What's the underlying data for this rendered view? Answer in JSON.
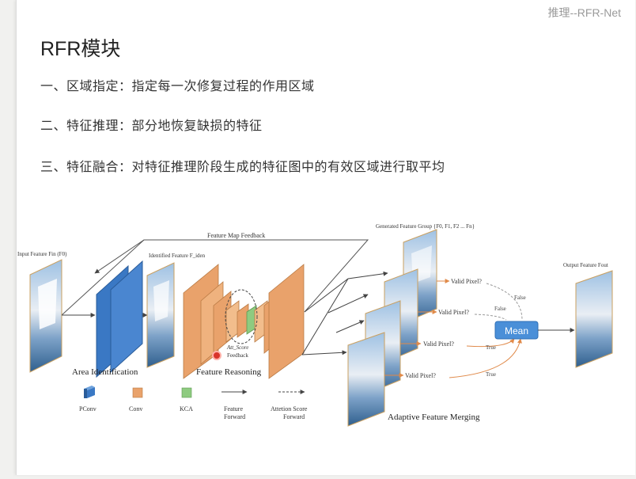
{
  "header": {
    "text": "推理--RFR-Net"
  },
  "title": "RFR模块",
  "bullets": [
    "一、区域指定：指定每一次修复过程的作用区域",
    "二、特征推理：部分地恢复缺损的特征",
    "三、特征融合：对特征推理阶段生成的特征图中的有效区域进行取平均"
  ],
  "diagram": {
    "feedback_label": "Feature Map Feedback",
    "input_label": "Input Feature Fin (F0)",
    "identified_label": "Identified Feature F_iden",
    "generated_label": "Generated Feature Group {F0, F1, F2 ... Fn}",
    "output_label": "Output Feature Fout",
    "att_label": "Att_Score",
    "att_label2": "Feedback",
    "valid_pixel": "Valid Pixel?",
    "mean": "Mean",
    "false_label": "False",
    "true_label": "True",
    "section_labels": {
      "area": "Area Identification",
      "reasoning": "Feature Reasoning",
      "merging": "Adaptive Feature Merging"
    },
    "legend": {
      "pconv": "PConv",
      "conv": "Conv",
      "kca": "KCA",
      "feature_forward": [
        "Feature",
        "Forward"
      ],
      "attention_forward": [
        "Attetion Score",
        "Forward"
      ]
    },
    "colors": {
      "pconv": "#3a78c4",
      "conv": "#e9a26b",
      "kca": "#8ecb80",
      "mean": "#4a8fd8",
      "true_arrow": "#e08a4a"
    }
  }
}
